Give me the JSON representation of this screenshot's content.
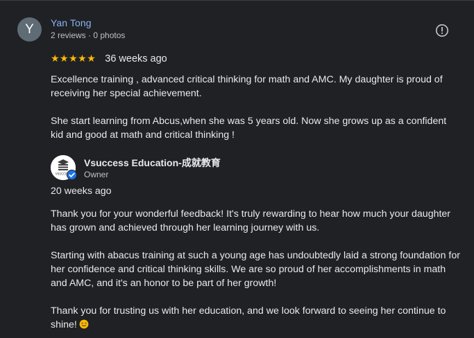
{
  "review": {
    "avatar_letter": "Y",
    "reviewer_name": "Yan Tong",
    "reviewer_meta": "2 reviews · 0 photos",
    "stars": "★★★★★",
    "rating": 5,
    "time": "36 weeks ago",
    "paragraph_1": "Excellence training , advanced critical thinking for math and AMC. My daughter is proud of receiving her special achievement.",
    "paragraph_2": "She start learning from Abcus,when she was 5 years old. Now she grows up as a confident kid and good at math and critical thinking !"
  },
  "owner_reply": {
    "owner_name": "Vsuccess Education-成就教育",
    "owner_role": "Owner",
    "logo_text": "VSUCCESS",
    "time": "20 weeks ago",
    "paragraph_1": "Thank you for your wonderful feedback! It's truly rewarding to hear how much your daughter has grown and achieved through her learning journey with us.",
    "paragraph_2": "Starting with abacus training at such a young age has undoubtedly laid a strong foundation for her confidence and critical thinking skills. We are so proud of her accomplishments in math and AMC, and it's an honor to be part of her growth!",
    "paragraph_3": "Thank you for trusting us with her education, and we look forward to seeing her continue to shine!",
    "emoji": "smiling-face-emoji"
  },
  "icons": {
    "report": "report-icon",
    "verified": "verified-badge-icon"
  },
  "colors": {
    "background": "#202124",
    "name_link": "#8ab4f8",
    "star": "#fbbc04",
    "text": "#e8eaed",
    "secondary_text": "#bdc1c6",
    "verified_badge": "#1a73e8"
  }
}
